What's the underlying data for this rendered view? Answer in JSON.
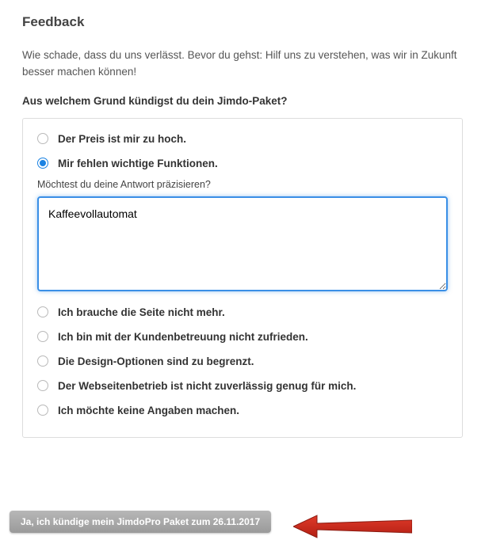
{
  "title": "Feedback",
  "intro": "Wie schade, dass du uns verlässt. Bevor du gehst: Hilf uns zu verstehen, was wir in Zukunft besser machen können!",
  "question": "Aus welchem Grund kündigst du dein Jimdo-Paket?",
  "options": [
    {
      "label": "Der Preis ist mir zu hoch.",
      "selected": false
    },
    {
      "label": "Mir fehlen wichtige Funktionen.",
      "selected": true
    },
    {
      "label": "Ich brauche die Seite nicht mehr.",
      "selected": false
    },
    {
      "label": "Ich bin mit der Kundenbetreuung nicht zufrieden.",
      "selected": false
    },
    {
      "label": "Die Design-Optionen sind zu begrenzt.",
      "selected": false
    },
    {
      "label": "Der Webseitenbetrieb ist nicht zuverlässig genug für mich.",
      "selected": false
    },
    {
      "label": "Ich möchte keine Angaben machen.",
      "selected": false
    }
  ],
  "sub_question": "Möchtest du deine Antwort präzisieren?",
  "answer_text": "Kaffeevollautomat",
  "submit_label": "Ja, ich kündige mein JimdoPro Paket zum 26.11.2017"
}
